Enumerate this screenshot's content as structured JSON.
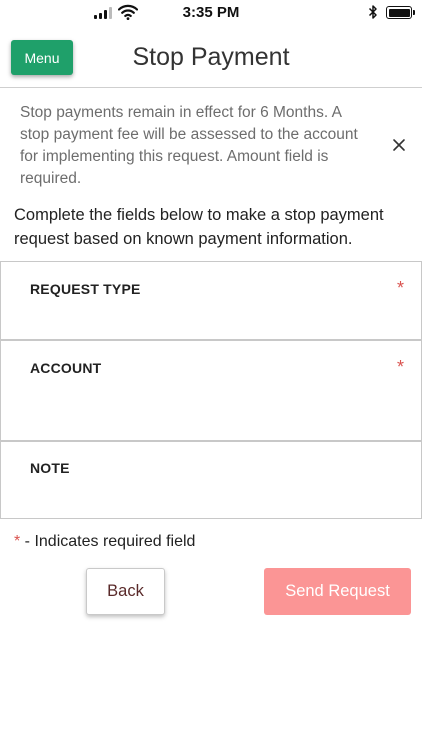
{
  "status_bar": {
    "time": "3:35 PM"
  },
  "header": {
    "menu_label": "Menu",
    "title": "Stop Payment"
  },
  "notice": {
    "text": "Stop payments remain in effect for 6 Months. A stop payment fee will be assessed to the account for implementing this request. Amount field is required."
  },
  "intro": "Complete the fields below to make a stop payment request based on known payment information.",
  "fields": [
    {
      "label": "REQUEST TYPE",
      "required_mark": "*"
    },
    {
      "label": "ACCOUNT",
      "required_mark": "*"
    },
    {
      "label": "NOTE"
    }
  ],
  "required_legend": {
    "star": "*",
    "text": " - Indicates required field"
  },
  "actions": {
    "back_label": "Back",
    "send_label": "Send Request"
  },
  "colors": {
    "menu_green": "#1fa06a",
    "send_pink": "#fb9595",
    "required_red": "#d9534f"
  }
}
